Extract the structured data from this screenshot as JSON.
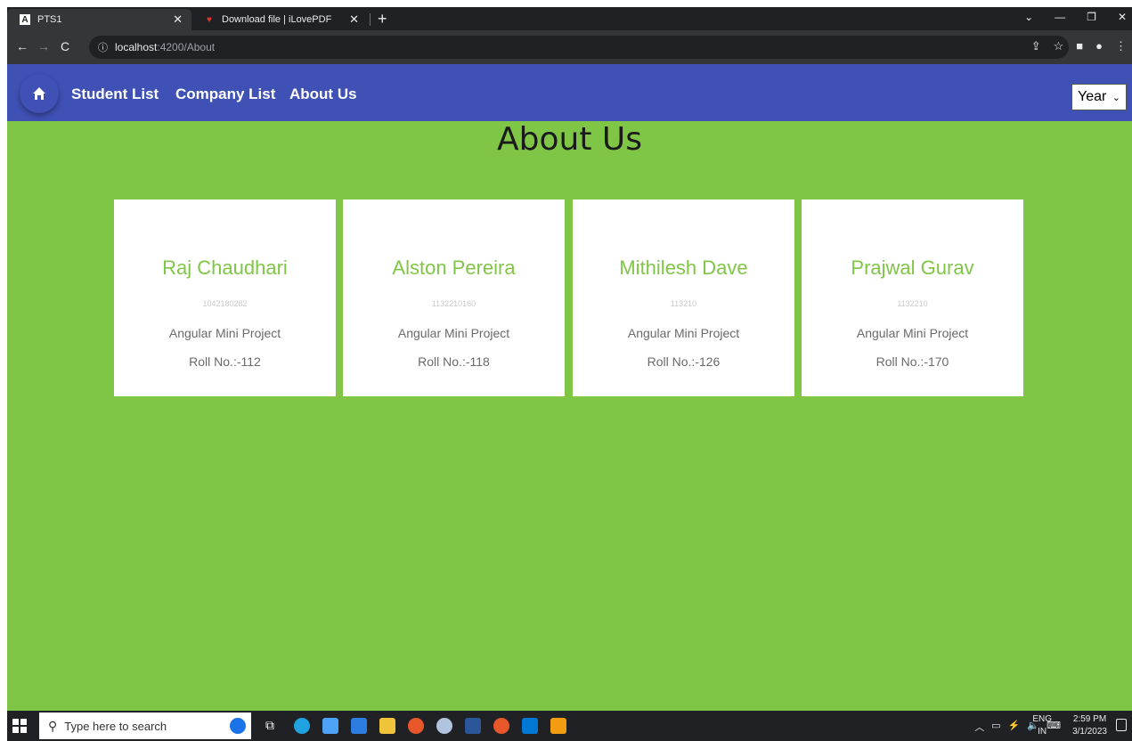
{
  "browser": {
    "tabs": [
      {
        "title": "PTS1",
        "favicon": "angular-icon"
      },
      {
        "title": "Download file | iLovePDF",
        "favicon": "ilovepdf-heart-icon"
      }
    ],
    "url_host": "localhost",
    "url_path": ":4200/About"
  },
  "navbar": {
    "links": [
      "Student List",
      "Company List",
      "About Us"
    ],
    "year_select": "Year",
    "brand_color": "#3f51b5"
  },
  "page": {
    "title": "About Us",
    "background_color": "#80c646",
    "cards": [
      {
        "name": "Raj Chaudhari",
        "id": "1042180282",
        "project": "Angular Mini Project",
        "roll": "Roll No.:-112"
      },
      {
        "name": "Alston Pereira",
        "id": "1132210160",
        "project": "Angular Mini Project",
        "roll": "Roll No.:-118"
      },
      {
        "name": "Mithilesh Dave",
        "id": "113210",
        "project": "Angular Mini Project",
        "roll": "Roll No.:-126"
      },
      {
        "name": "Prajwal Gurav",
        "id": "1132210",
        "project": "Angular Mini Project",
        "roll": "Roll No.:-170"
      }
    ]
  },
  "taskbar": {
    "search_placeholder": "Type here to search",
    "lang_line1": "ENG",
    "lang_line2": "IN",
    "time": "2:59 PM",
    "date": "3/1/2023"
  }
}
